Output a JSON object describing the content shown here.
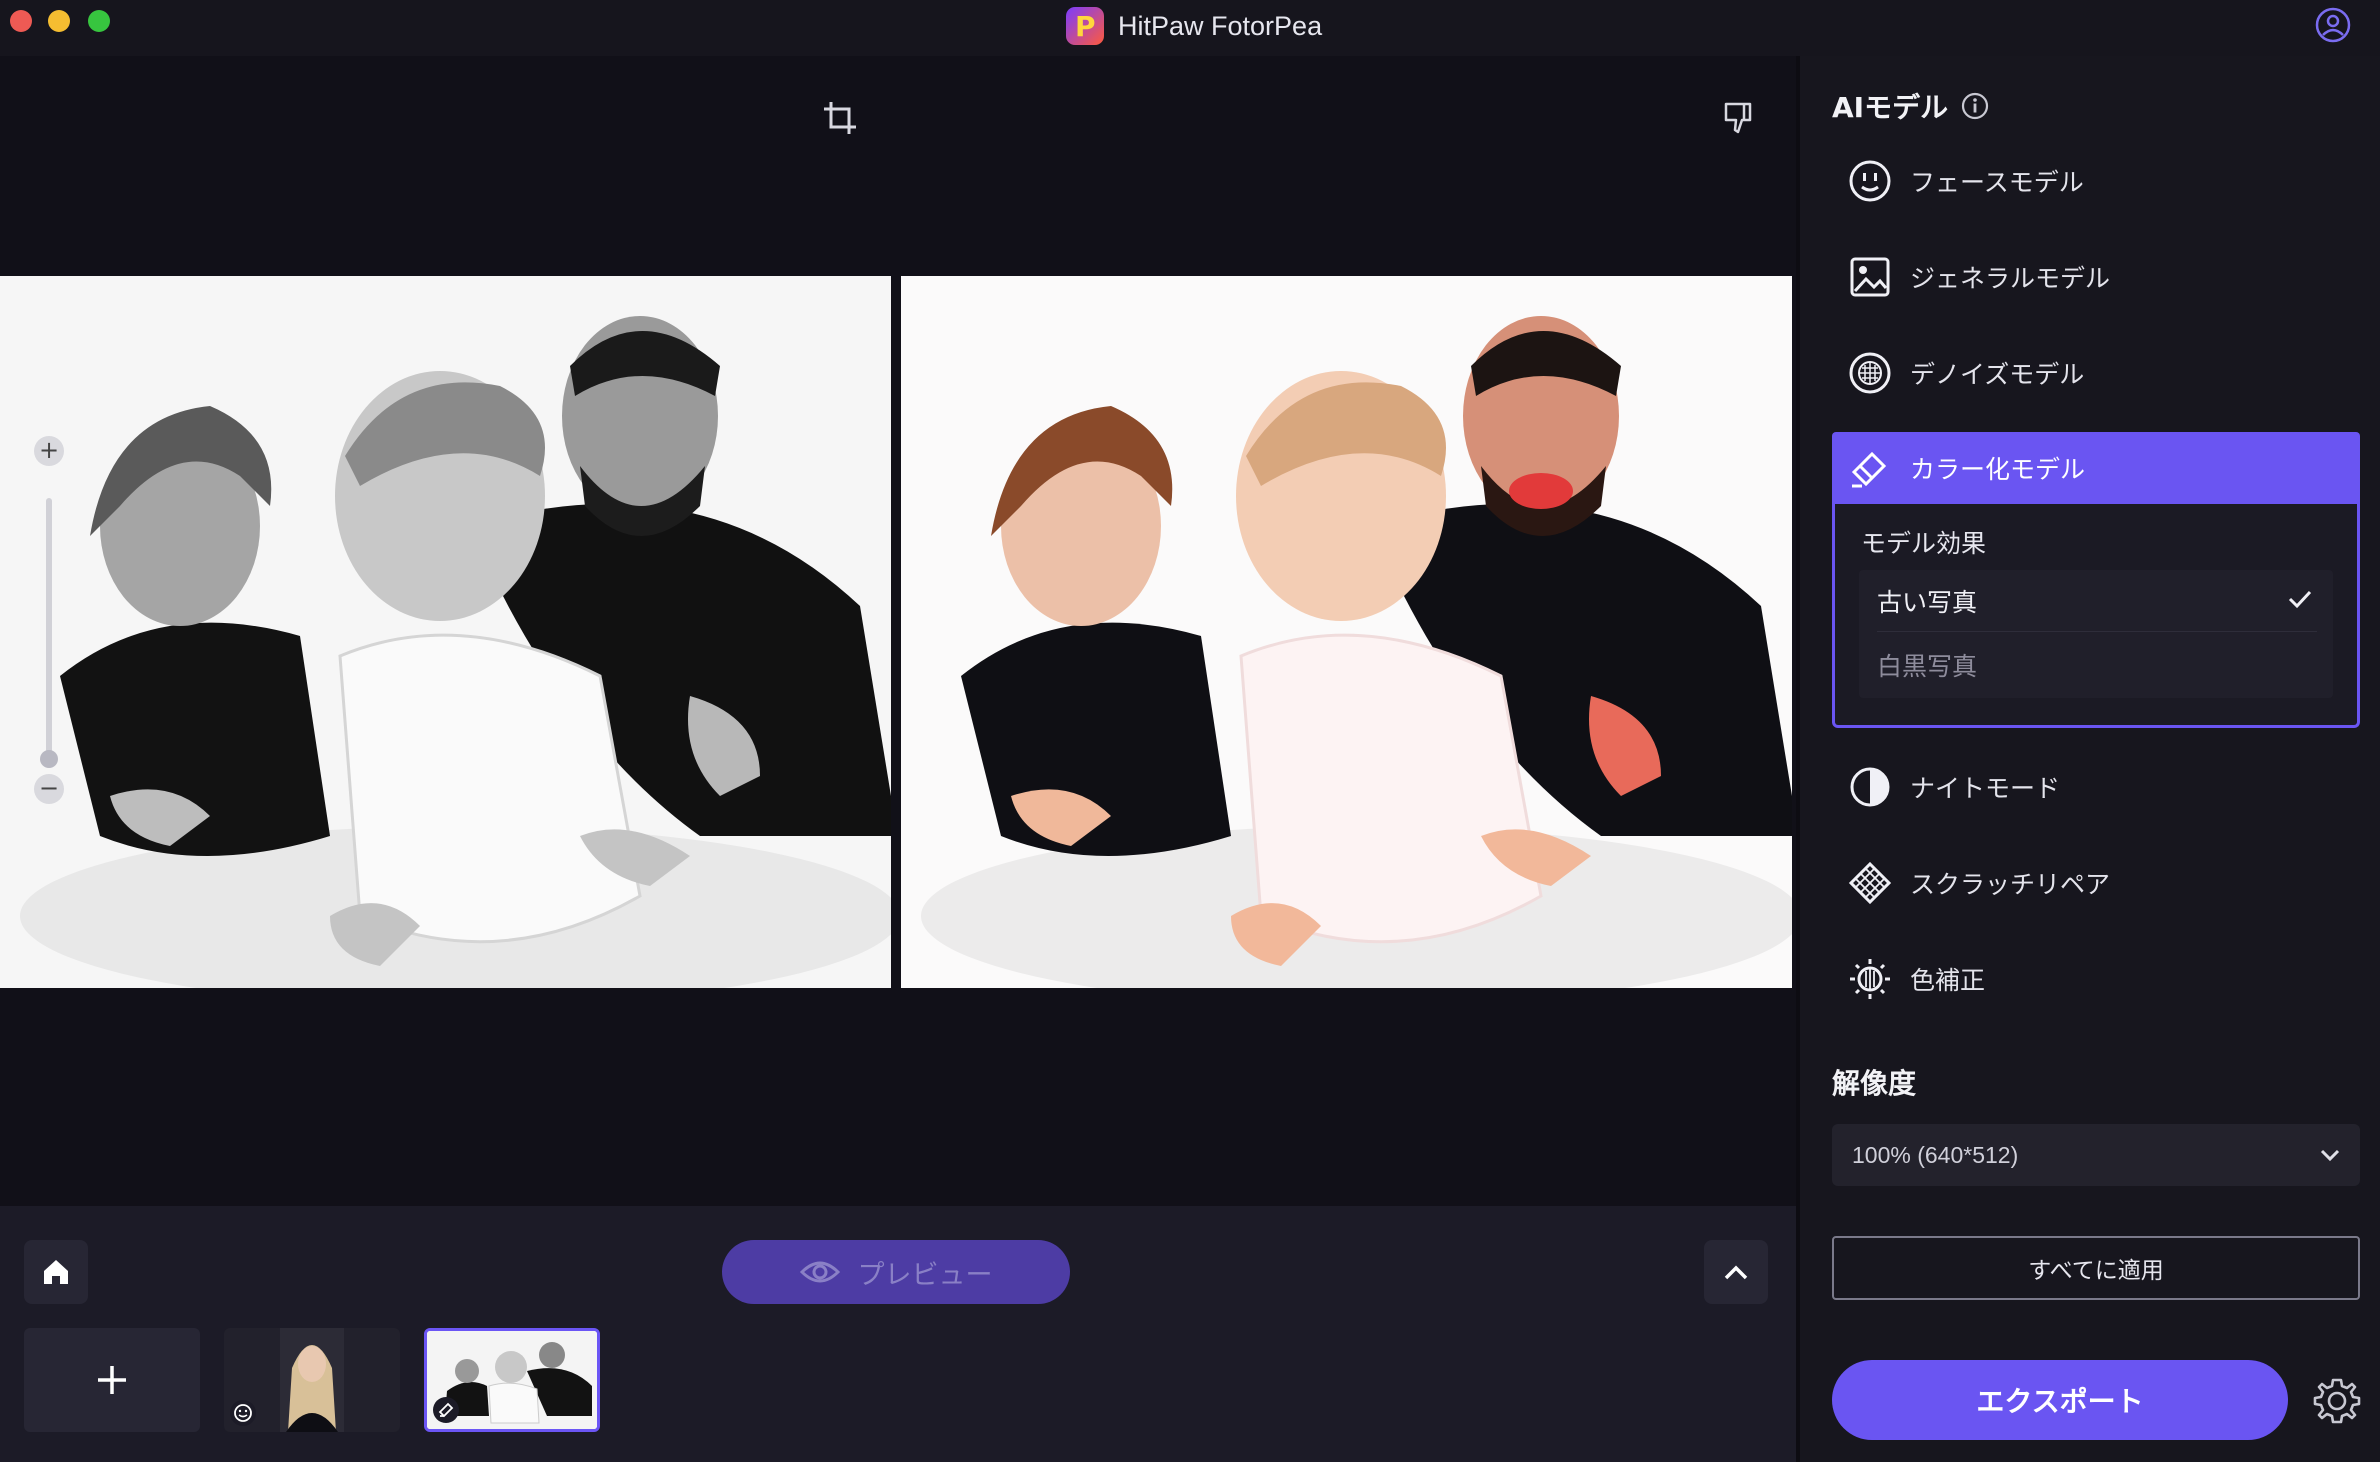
{
  "app": {
    "title": "HitPaw FotorPea"
  },
  "canvas": {
    "zoom_in_label": "+",
    "zoom_out_label": "−"
  },
  "bottom": {
    "preview_label": "プレビュー"
  },
  "panel": {
    "ai_model_title": "AIモデル",
    "models": [
      {
        "label": "フェースモデル",
        "icon": "face-icon"
      },
      {
        "label": "ジェネラルモデル",
        "icon": "image-icon"
      },
      {
        "label": "デノイズモデル",
        "icon": "denoise-icon"
      },
      {
        "label": "カラー化モデル",
        "icon": "colorize-icon",
        "active": true
      },
      {
        "label": "ナイトモード",
        "icon": "night-mode-icon"
      },
      {
        "label": "スクラッチリペア",
        "icon": "scratch-repair-icon"
      },
      {
        "label": "色補正",
        "icon": "color-correction-icon"
      }
    ],
    "effect": {
      "title": "モデル効果",
      "options": [
        {
          "label": "古い写真",
          "selected": true
        },
        {
          "label": "白黒写真",
          "selected": false
        }
      ]
    },
    "resolution_title": "解像度",
    "resolution_value": "100% (640*512)",
    "apply_all_label": "すべてに適用",
    "export_label": "エクスポート"
  },
  "colors": {
    "accent": "#6a55f2",
    "background": "#111018",
    "panel": "#17161e"
  }
}
